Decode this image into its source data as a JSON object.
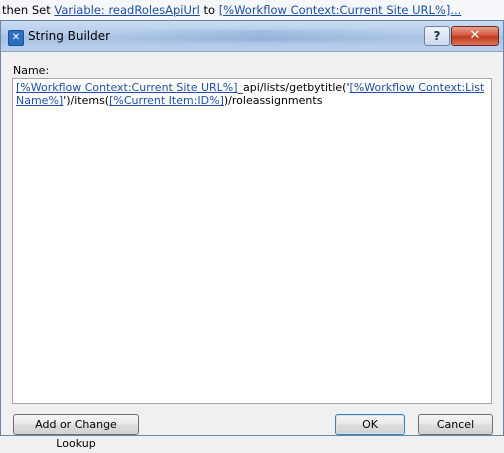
{
  "background": {
    "prefix": "then Set ",
    "variable_link": "Variable: readRolesApiUrl",
    "to_text": " to ",
    "value_link": "[%Workflow Context:Current Site URL%]..."
  },
  "dialog": {
    "title": "String Builder",
    "app_icon_glyph": "✕",
    "help_glyph": "?",
    "close_glyph": "✕",
    "name_label": "Name:",
    "content": {
      "token1": "[%Workflow Context:Current Site URL%]",
      "text1": "_api/lists/getbytitle('",
      "token2": "[%Workflow Context:List Name%]",
      "text2": "')/items(",
      "token3": "[%Current Item:ID%]",
      "text3": ")/roleassignments"
    },
    "buttons": {
      "lookup": "Add or Change Lookup",
      "ok": "OK",
      "cancel": "Cancel"
    }
  }
}
